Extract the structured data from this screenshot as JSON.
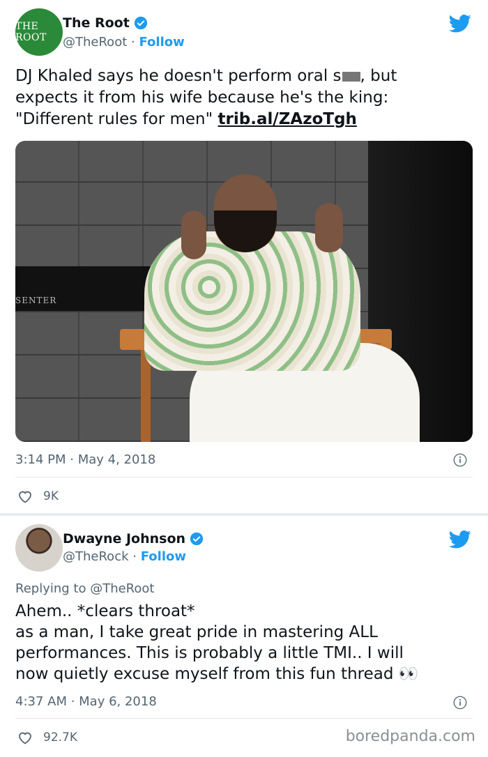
{
  "tweets": [
    {
      "avatar_text": "THE ROOT",
      "name": "The Root",
      "handle": "@TheRoot",
      "separator": "·",
      "follow_label": "Follow",
      "text_lines": [
        "DJ Khaled says he doesn't perform oral s",
        ", but",
        "expects it from his wife because he's the king:",
        "\"Different rules for men\" "
      ],
      "link_text": "trib.al/ZAzoTgh",
      "photo_sign_text": "SENTER",
      "timestamp": "3:14 PM · May 4, 2018",
      "likes": "9K"
    },
    {
      "name": "Dwayne Johnson",
      "handle": "@TheRock",
      "separator": "·",
      "follow_label": "Follow",
      "replying_to": "Replying to @TheRoot",
      "text_lines": [
        "Ahem.. *clears throat*",
        "as a man, I take great pride in mastering ALL",
        "performances. This is probably a little TMI.. I will",
        "now quietly excuse myself from this fun thread 👀"
      ],
      "timestamp": "4:37 AM · May 6, 2018",
      "likes": "92.7K"
    }
  ],
  "watermark": "boredpanda.com",
  "icons": [
    "verified-icon",
    "twitter-bird-icon",
    "info-icon",
    "heart-icon",
    "eyes-emoji"
  ],
  "colors": {
    "twitter_blue": "#1d9bf0",
    "text": "#0f1419",
    "muted": "#536471",
    "root_green": "#2b8a3a"
  }
}
